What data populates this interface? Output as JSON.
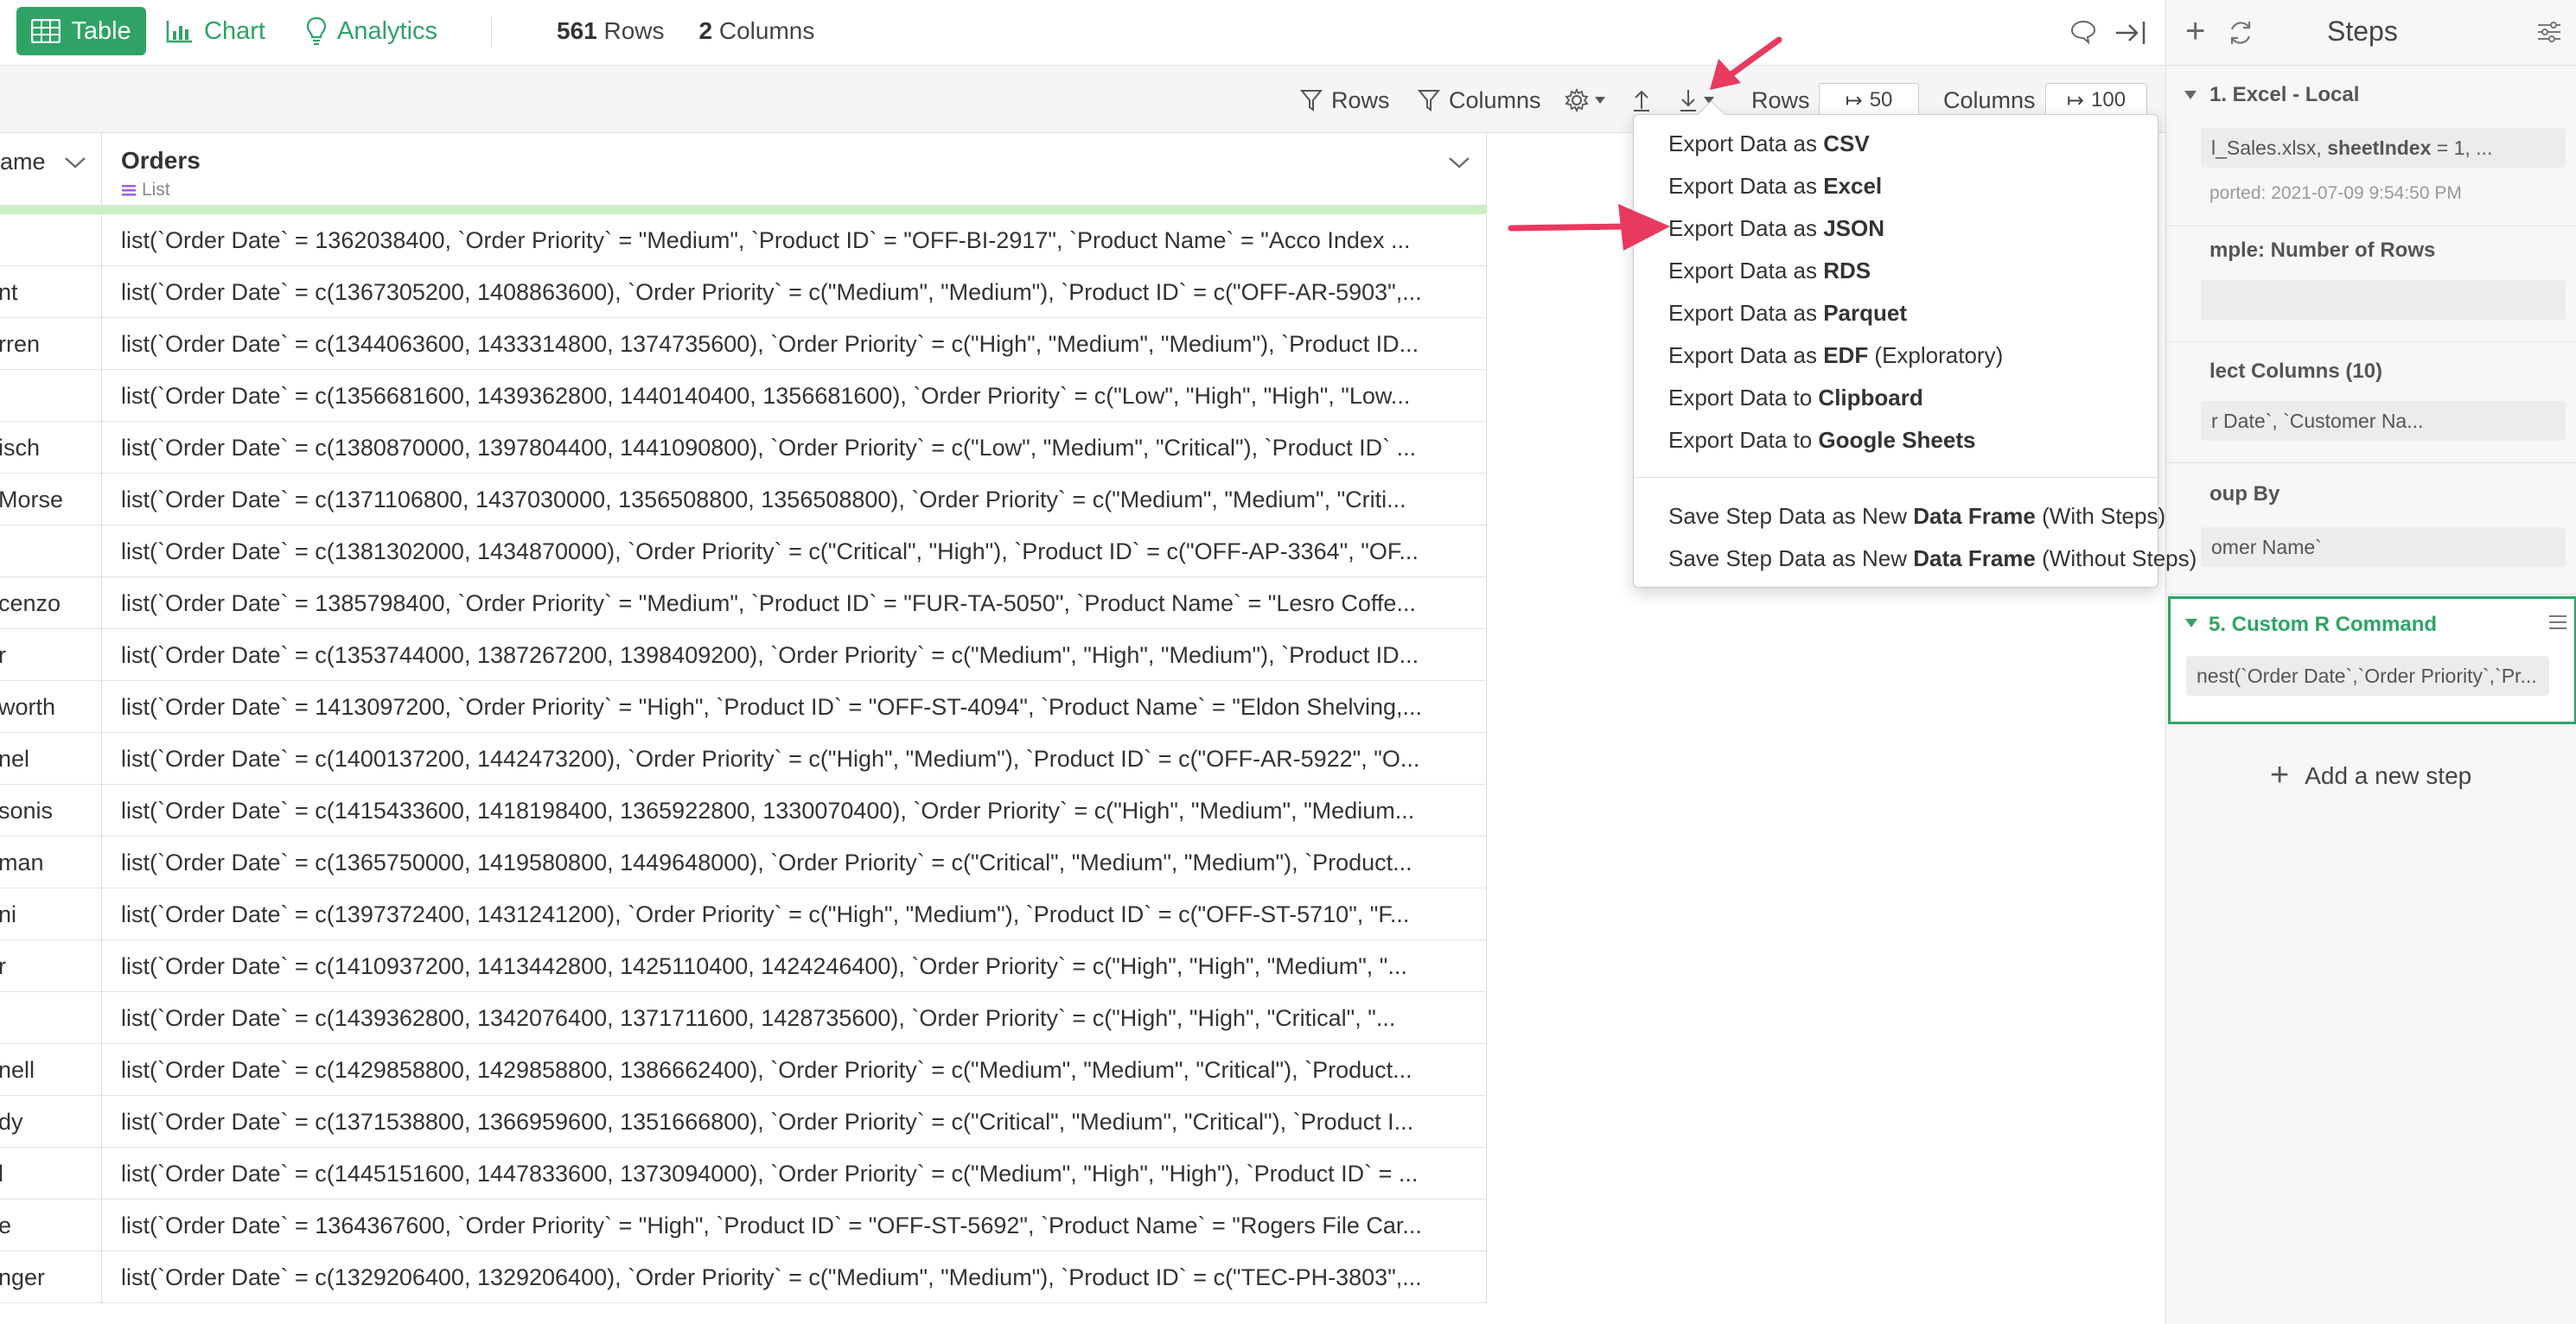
{
  "app": {
    "tabs": [
      {
        "label": "Table",
        "active": true
      },
      {
        "label": "Chart",
        "active": false
      },
      {
        "label": "Analytics",
        "active": false
      }
    ],
    "rows_count": "561",
    "rows_label": "Rows",
    "cols_count": "2",
    "cols_label": "Columns",
    "accent": "#2fa365"
  },
  "toolbar": {
    "rows_filter": "Rows",
    "columns_filter": "Columns",
    "rows_label": "Rows",
    "rows_value": "50",
    "columns_label": "Columns",
    "columns_value": "100"
  },
  "grid": {
    "col1_header": "lame",
    "col2_header": "Orders",
    "col2_type": "List",
    "rows": [
      {
        "c1": "",
        "c2": "list(`Order Date` = 1362038400, `Order Priority` = \"Medium\", `Product ID` = \"OFF-BI-2917\", `Product Name` = \"Acco Index ..."
      },
      {
        "c1": "nt",
        "c2": "list(`Order Date` = c(1367305200, 1408863600), `Order Priority` = c(\"Medium\", \"Medium\"), `Product ID` = c(\"OFF-AR-5903\",..."
      },
      {
        "c1": "rren",
        "c2": "list(`Order Date` = c(1344063600, 1433314800, 1374735600), `Order Priority` = c(\"High\", \"Medium\", \"Medium\"), `Product ID..."
      },
      {
        "c1": "",
        "c2": "list(`Order Date` = c(1356681600, 1439362800, 1440140400, 1356681600), `Order Priority` = c(\"Low\", \"High\", \"High\", \"Low..."
      },
      {
        "c1": "isch",
        "c2": "list(`Order Date` = c(1380870000, 1397804400, 1441090800), `Order Priority` = c(\"Low\", \"Medium\", \"Critical\"), `Product ID` ..."
      },
      {
        "c1": "Morse",
        "c2": "list(`Order Date` = c(1371106800, 1437030000, 1356508800, 1356508800), `Order Priority` = c(\"Medium\", \"Medium\", \"Criti..."
      },
      {
        "c1": "",
        "c2": "list(`Order Date` = c(1381302000, 1434870000), `Order Priority` = c(\"Critical\", \"High\"), `Product ID` = c(\"OFF-AP-3364\", \"OF..."
      },
      {
        "c1": "cenzo",
        "c2": "list(`Order Date` = 1385798400, `Order Priority` = \"Medium\", `Product ID` = \"FUR-TA-5050\", `Product Name` = \"Lesro Coffe..."
      },
      {
        "c1": "r",
        "c2": "list(`Order Date` = c(1353744000, 1387267200, 1398409200), `Order Priority` = c(\"Medium\", \"High\", \"Medium\"), `Product ID..."
      },
      {
        "c1": "worth",
        "c2": "list(`Order Date` = 1413097200, `Order Priority` = \"High\", `Product ID` = \"OFF-ST-4094\", `Product Name` = \"Eldon Shelving,..."
      },
      {
        "c1": "nel",
        "c2": "list(`Order Date` = c(1400137200, 1442473200), `Order Priority` = c(\"High\", \"Medium\"), `Product ID` = c(\"OFF-AR-5922\", \"O..."
      },
      {
        "c1": "sonis",
        "c2": "list(`Order Date` = c(1415433600, 1418198400, 1365922800, 1330070400), `Order Priority` = c(\"High\", \"Medium\", \"Medium..."
      },
      {
        "c1": "man",
        "c2": "list(`Order Date` = c(1365750000, 1419580800, 1449648000), `Order Priority` = c(\"Critical\", \"Medium\", \"Medium\"), `Product..."
      },
      {
        "c1": "ni",
        "c2": "list(`Order Date` = c(1397372400, 1431241200), `Order Priority` = c(\"High\", \"Medium\"), `Product ID` = c(\"OFF-ST-5710\", \"F..."
      },
      {
        "c1": "r",
        "c2": "list(`Order Date` = c(1410937200, 1413442800, 1425110400, 1424246400), `Order Priority` = c(\"High\", \"High\", \"Medium\", \"..."
      },
      {
        "c1": "",
        "c2": "list(`Order Date` = c(1439362800, 1342076400, 1371711600, 1428735600), `Order Priority` = c(\"High\", \"High\", \"Critical\", \"..."
      },
      {
        "c1": "nell",
        "c2": "list(`Order Date` = c(1429858800, 1429858800, 1386662400), `Order Priority` = c(\"Medium\", \"Medium\", \"Critical\"), `Product..."
      },
      {
        "c1": "dy",
        "c2": "list(`Order Date` = c(1371538800, 1366959600, 1351666800), `Order Priority` = c(\"Critical\", \"Medium\", \"Critical\"), `Product I..."
      },
      {
        "c1": "l",
        "c2": "list(`Order Date` = c(1445151600, 1447833600, 1373094000), `Order Priority` = c(\"Medium\", \"High\", \"High\"), `Product ID` = ..."
      },
      {
        "c1": "e",
        "c2": "list(`Order Date` = 1364367600, `Order Priority` = \"High\", `Product ID` = \"OFF-ST-5692\", `Product Name` = \"Rogers File Car..."
      },
      {
        "c1": "nger",
        "c2": "list(`Order Date` = c(1329206400, 1329206400), `Order Priority` = c(\"Medium\", \"Medium\"), `Product ID` = c(\"TEC-PH-3803\",..."
      }
    ]
  },
  "menu": {
    "items": [
      {
        "pre": "Export Data as ",
        "bold": "CSV",
        "post": ""
      },
      {
        "pre": "Export Data as ",
        "bold": "Excel",
        "post": ""
      },
      {
        "pre": "Export Data as ",
        "bold": "JSON",
        "post": ""
      },
      {
        "pre": "Export Data as ",
        "bold": "RDS",
        "post": ""
      },
      {
        "pre": "Export Data as ",
        "bold": "Parquet",
        "post": ""
      },
      {
        "pre": "Export Data as ",
        "bold": "EDF",
        "post": " (Exploratory)"
      },
      {
        "pre": "Export Data to ",
        "bold": "Clipboard",
        "post": ""
      },
      {
        "pre": "Export Data to ",
        "bold": "Google Sheets",
        "post": ""
      },
      {
        "pre": "Save Step Data as New ",
        "bold": "Data Frame",
        "post": " (With Steps)"
      },
      {
        "pre": "Save Step Data as New ",
        "bold": "Data Frame",
        "post": " (Without Steps)"
      }
    ]
  },
  "steps": {
    "title": "Steps",
    "step1_title": "1. Excel - Local",
    "step1_box_pre": "l_Sales.xlsx, ",
    "step1_box_bold": "sheetIndex",
    "step1_box_post": " = 1, ...",
    "step1_sub": "ported: 2021-07-09 9:54:50 PM",
    "step2_title": "mple: Number of Rows",
    "step3_title": "lect Columns (10)",
    "step3_box": "r Date`, `Customer Na...",
    "step4_title": "oup By",
    "step4_box": "omer Name`",
    "step5_title": "5. Custom R Command",
    "step5_box": "nest(`Order Date`,`Order Priority`,`Pr...",
    "add_step": "Add a new step"
  }
}
